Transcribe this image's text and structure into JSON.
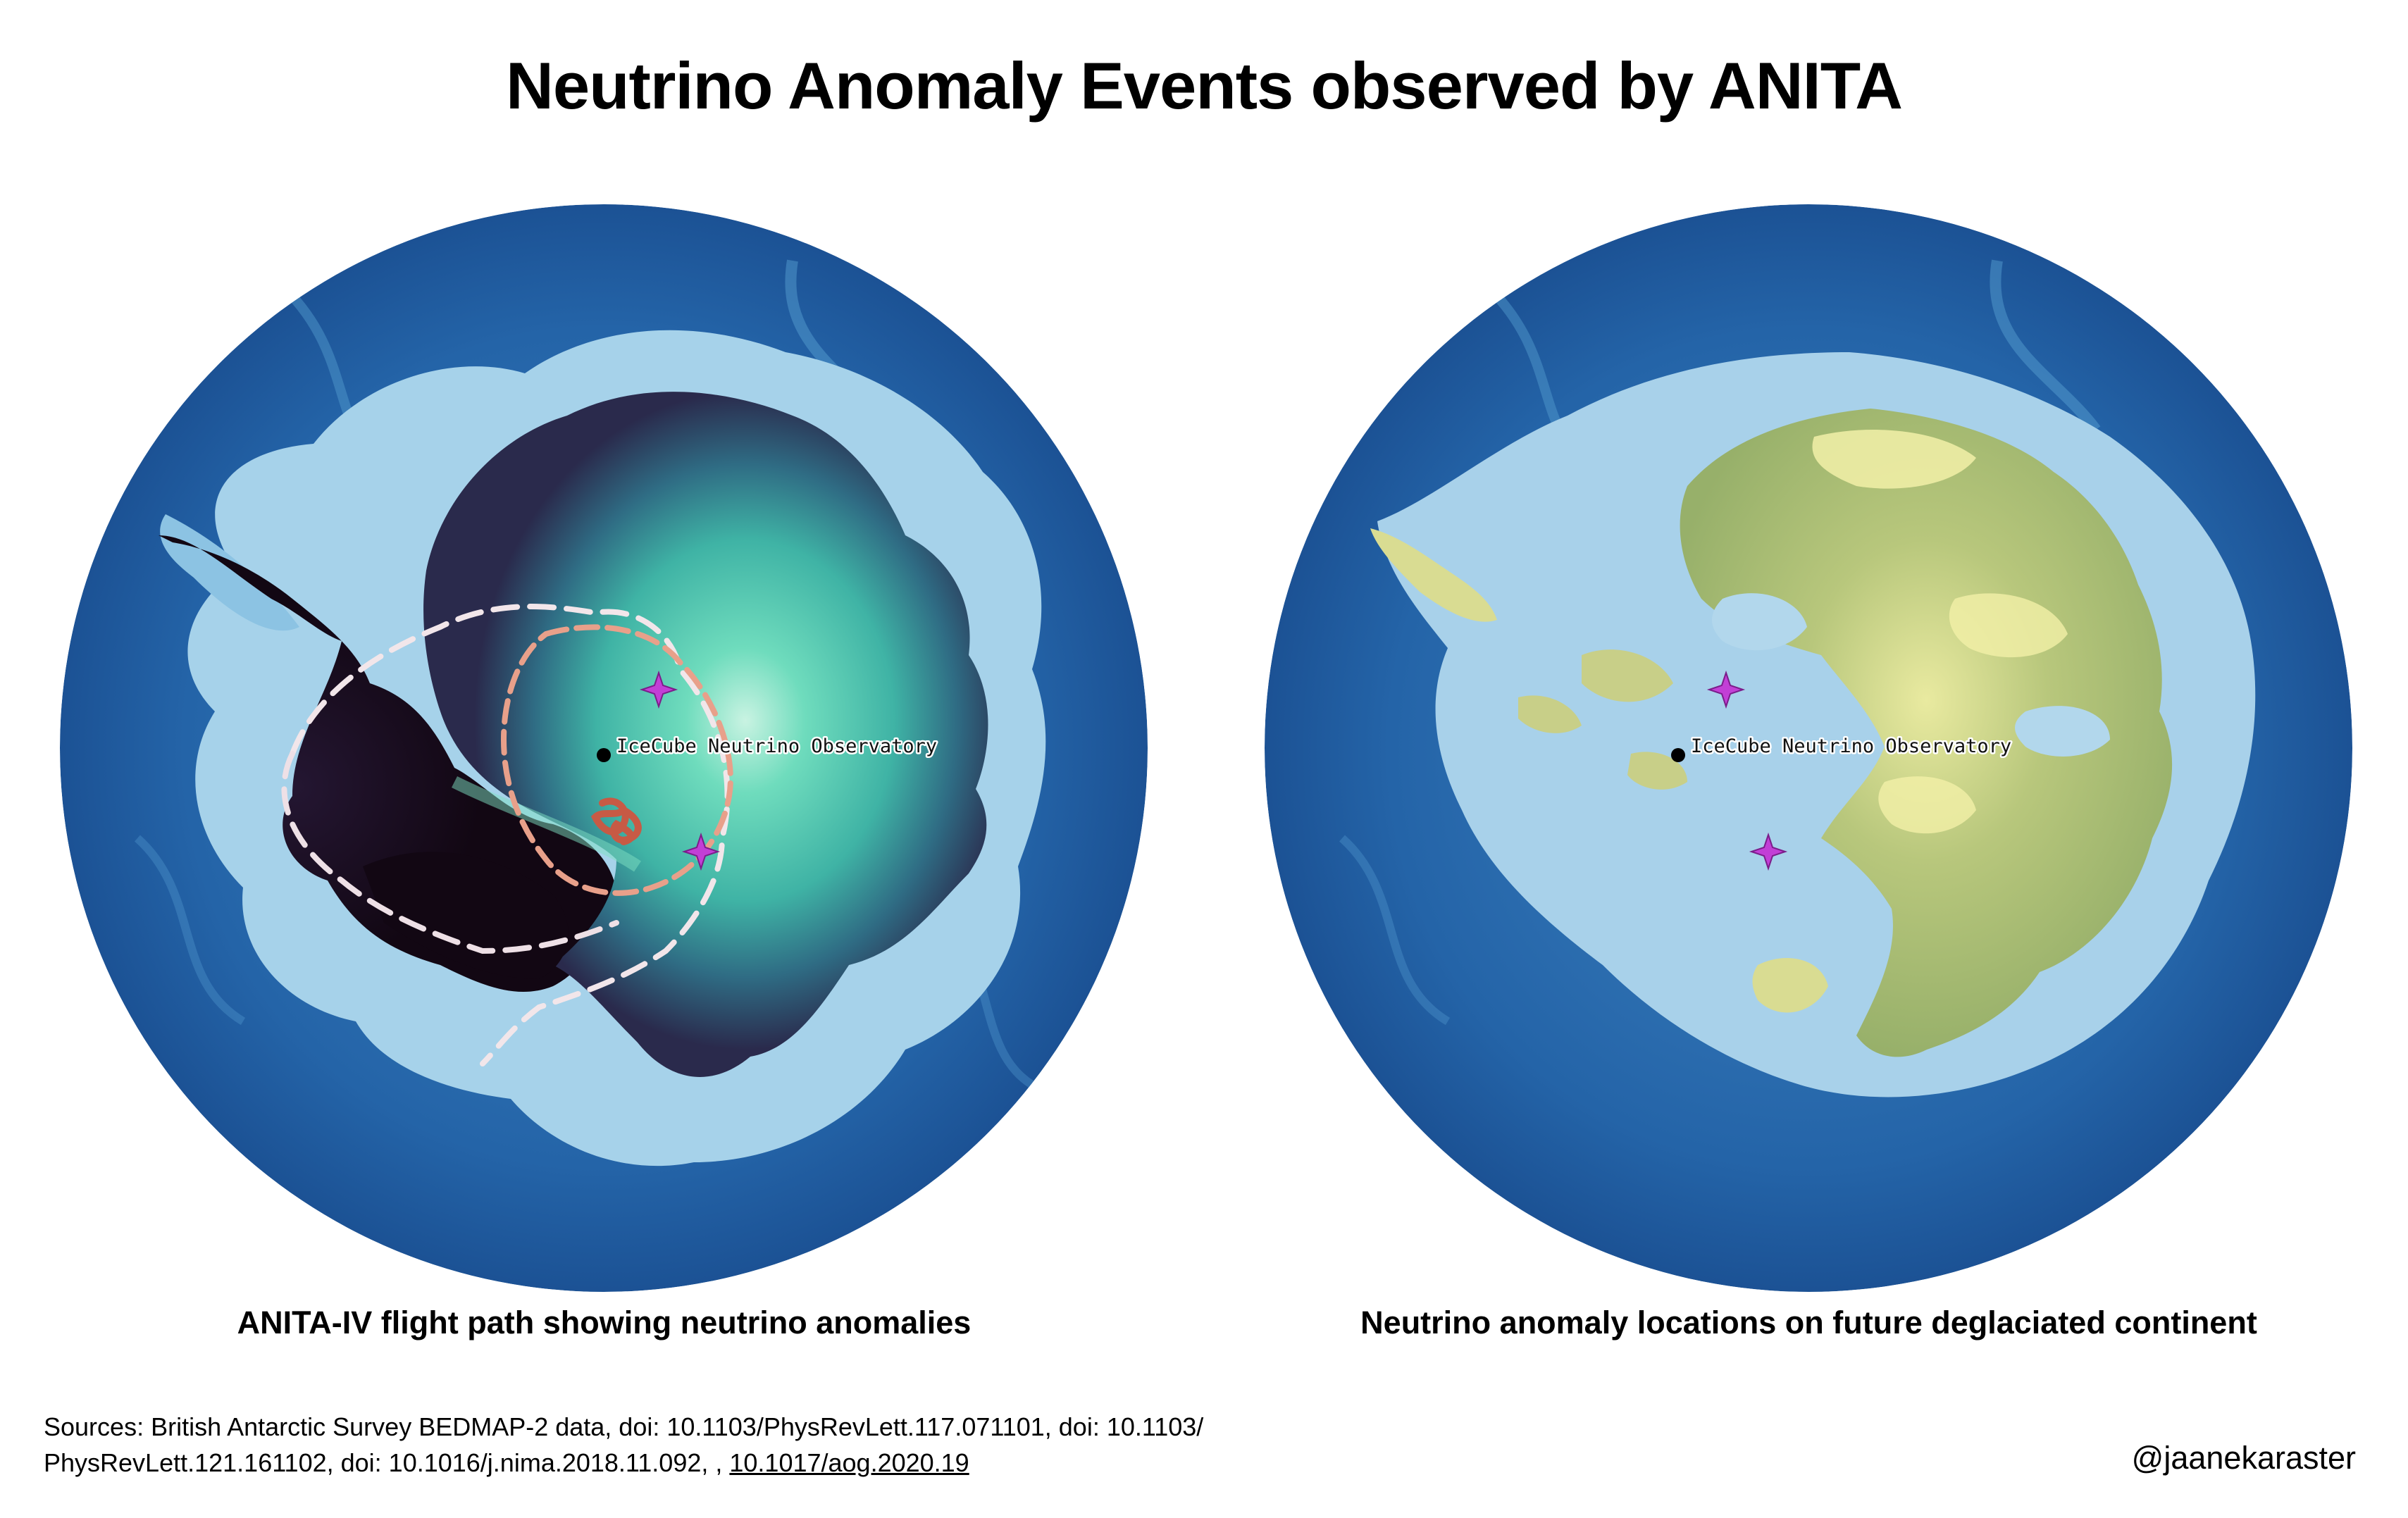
{
  "title": "Neutrino Anomaly Events observed by ANITA",
  "maps": [
    {
      "caption": "ANITA-IV flight path showing neutrino anomalies",
      "observatory_label": "IceCube Neutrino Observatory",
      "layers": [
        "BEDMAP-2 bed elevation",
        "ice surface",
        "ANITA-IV flight path"
      ]
    },
    {
      "caption": "Neutrino anomaly locations on future deglaciated continent",
      "observatory_label": "IceCube Neutrino Observatory",
      "layers": [
        "BEDMAP-2 bed elevation",
        "deglaciated land"
      ]
    }
  ],
  "markers": {
    "observatory": {
      "label": "IceCube Neutrino Observatory",
      "icon": "black-dot-icon"
    },
    "anomaly_events": [
      {
        "icon": "purple-star-icon"
      },
      {
        "icon": "purple-star-icon"
      }
    ]
  },
  "colors": {
    "ocean_deep": "#1a4f91",
    "ocean_shelf": "#a9d3ea",
    "ice_low": "#1c0b1e",
    "ice_high": "#5fd4b4",
    "land": "#9eb672",
    "land_high": "#f2f0a8",
    "flight_path_outer": "#f2e6ea",
    "flight_path_mid": "#e8a08a",
    "flight_path_inner": "#c75a45",
    "anomaly_marker": "#c23fd6"
  },
  "footer": {
    "sources_text": "Sources: British Antarctic Survey BEDMAP-2 data, doi: 10.1103/PhysRevLett.117.071101, doi: 10.1103/ PhysRevLett.121.161102, doi: 10.1016/j.nima.2018.11.092, , ",
    "sources_link": "10.1017/aog.2020.19",
    "handle": "@jaanekaraster"
  }
}
